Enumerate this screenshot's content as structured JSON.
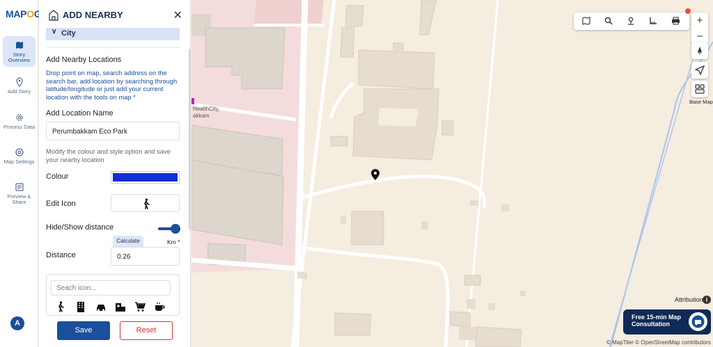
{
  "brand": {
    "logo_pre": "MAP",
    "logo_o": "O",
    "logo_post": "G"
  },
  "rail": {
    "items": [
      {
        "label": "Story Overview"
      },
      {
        "label": "Add Story"
      },
      {
        "label": "Process Data"
      },
      {
        "label": "Map Settings"
      },
      {
        "label": "Preview & Share"
      }
    ],
    "avatar_letter": "A"
  },
  "panel": {
    "title": "ADD NEARBY",
    "collapsed_section": "City",
    "section_heading": "Add Nearby Locations",
    "instructions": "Drop point on map, search address on the search bar, add location by searching through latitude/longitude or just add your current location with the tools on map *",
    "name_label": "Add Location Name",
    "name_value": "Perumbakkam Eco Park",
    "style_hint": "Modify the colour and style option and save your nearby location",
    "colour_label": "Colour",
    "colour_value": "#0e2fd6",
    "edit_icon_label": "Edit Icon",
    "edit_icon_value": "walking-person-icon",
    "distance_toggle_label": "Hide/Show distance",
    "distance_toggle_on": true,
    "calculate_label": "Calculate",
    "unit_label": "Km *",
    "distance_label": "Distance",
    "distance_value": "0.26",
    "icon_search_placeholder": "Seach icon...",
    "icon_options": [
      "walking-person-icon",
      "building-icon",
      "car-icon",
      "hospital-icon",
      "cart-icon",
      "coffee-cup-icon"
    ],
    "save_label": "Save",
    "reset_label": "Reset"
  },
  "map": {
    "poi_label_line1": "HealthCity,",
    "poi_label_line2": "akkam",
    "toolbar_tools": [
      "map-icon",
      "search-icon",
      "location-pin-icon",
      "ruler-icon",
      "print-icon"
    ],
    "zoom_in": "+",
    "zoom_out": "−",
    "base_map_label": "Base Map",
    "attribution_label": "Attribution",
    "consult_line1": "Free 15-min Map",
    "consult_line2": "Consultation",
    "credits": "© MapTiler © OpenStreetMap contributors"
  }
}
